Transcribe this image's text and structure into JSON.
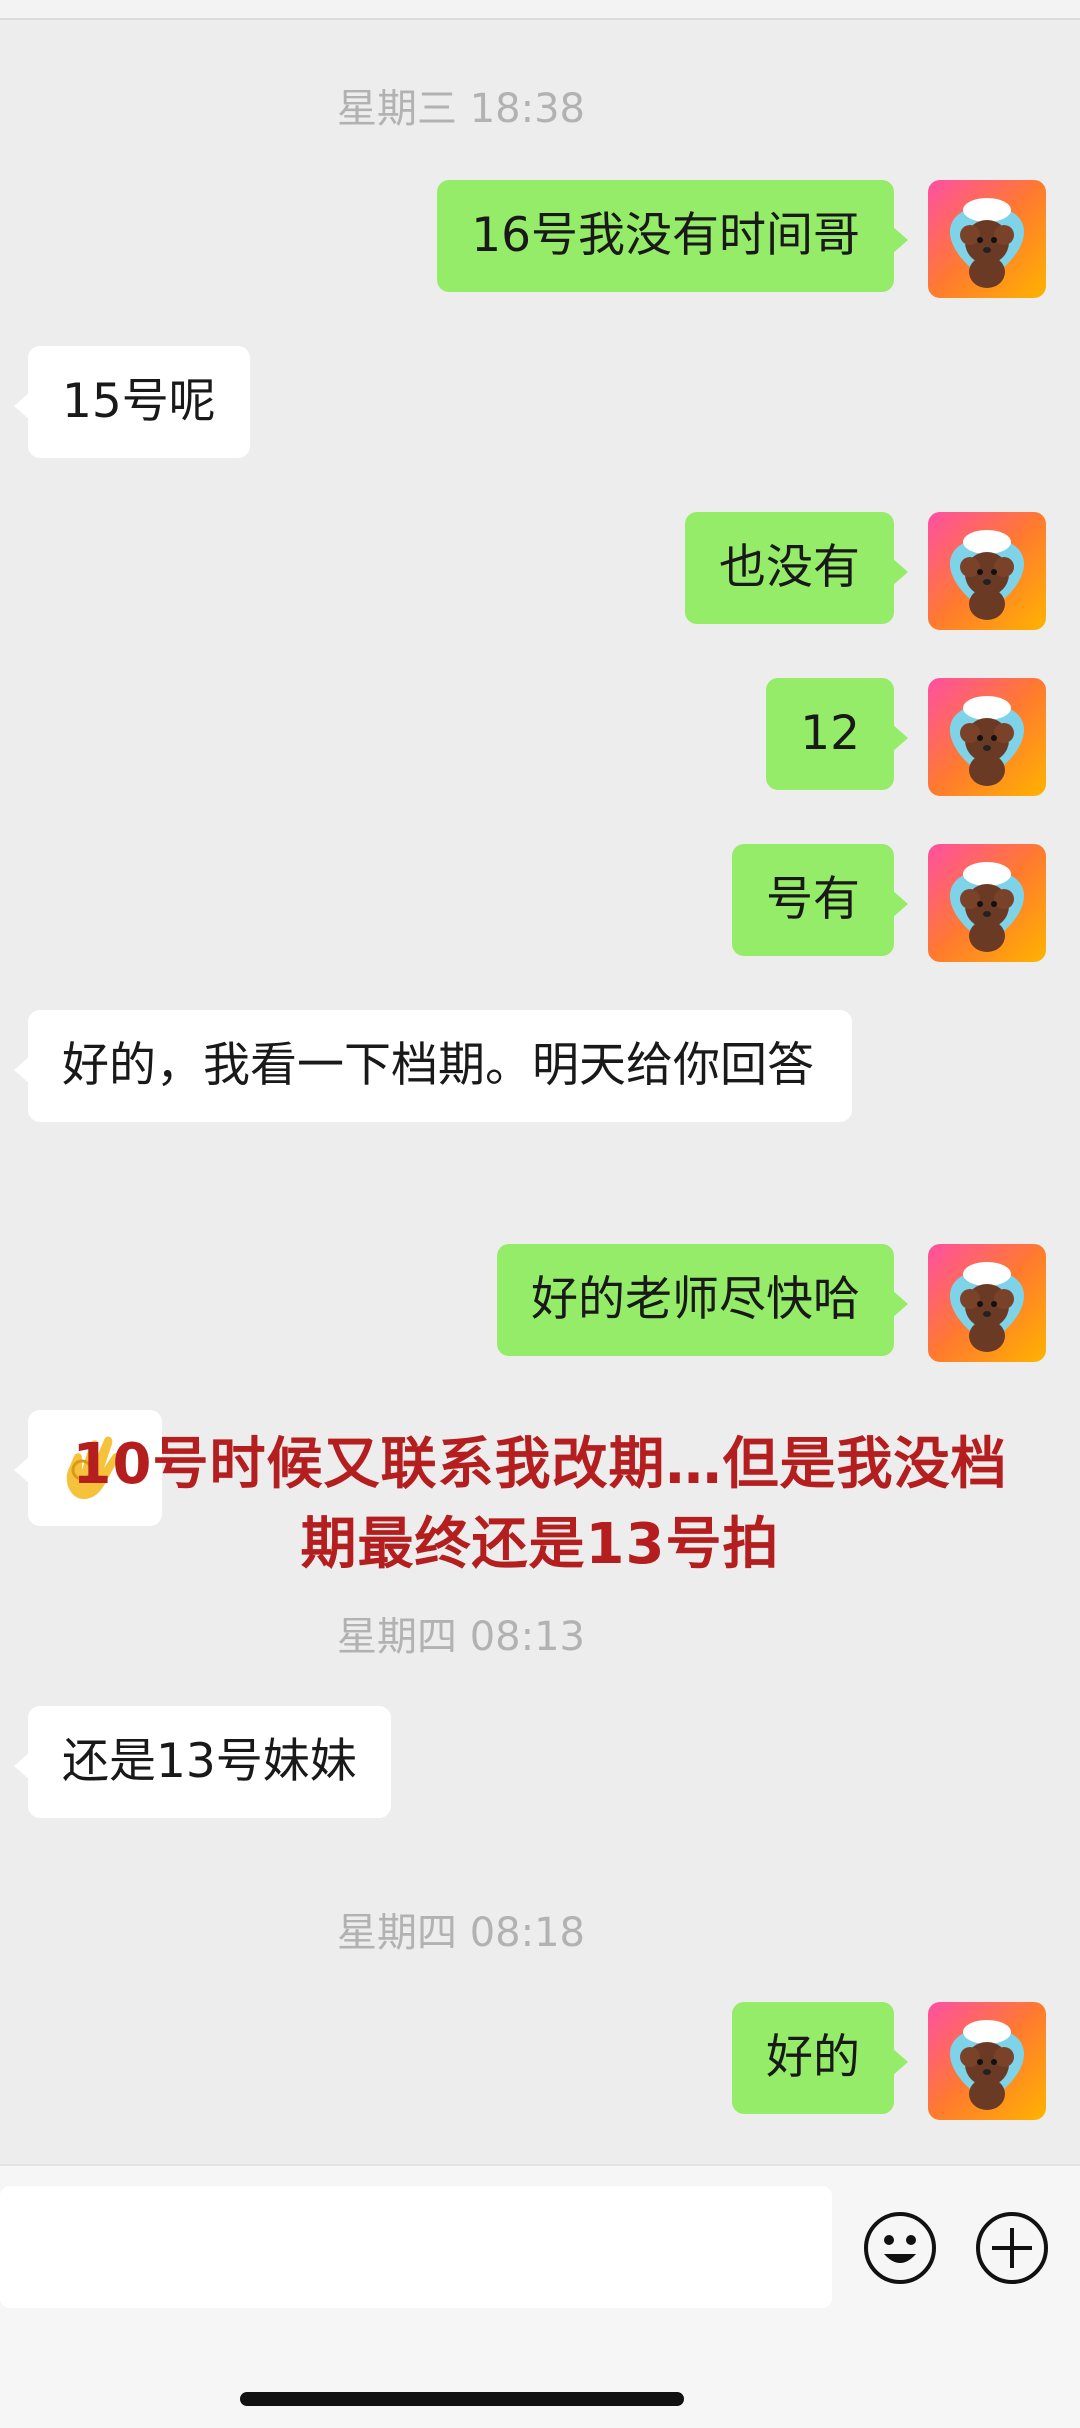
{
  "timestamps": {
    "t1": "星期三 18:38",
    "t2": "星期四 08:13",
    "t3": "星期四 08:18"
  },
  "messages": {
    "m1": "16号我没有时间哥",
    "m2": "15号呢",
    "m3": "也没有",
    "m4": "12",
    "m5": "号有",
    "m6": "好的，我看一下档期。明天给你回答",
    "m7": "好的老师尽快哈",
    "m8": "",
    "m9": "还是13号妹妹",
    "m10": "好的"
  },
  "overlay": {
    "line1": "10号时候又联系我改期…但是我没档",
    "line2": "期最终还是13号拍"
  },
  "input": {
    "value": "",
    "emoji_icon": "smiley-face-icon",
    "plus_icon": "plus-circle-icon"
  },
  "colors": {
    "sent_bubble": "#95ec69",
    "recv_bubble": "#ffffff",
    "background": "#ededed",
    "overlay_text": "#b51e1e"
  }
}
